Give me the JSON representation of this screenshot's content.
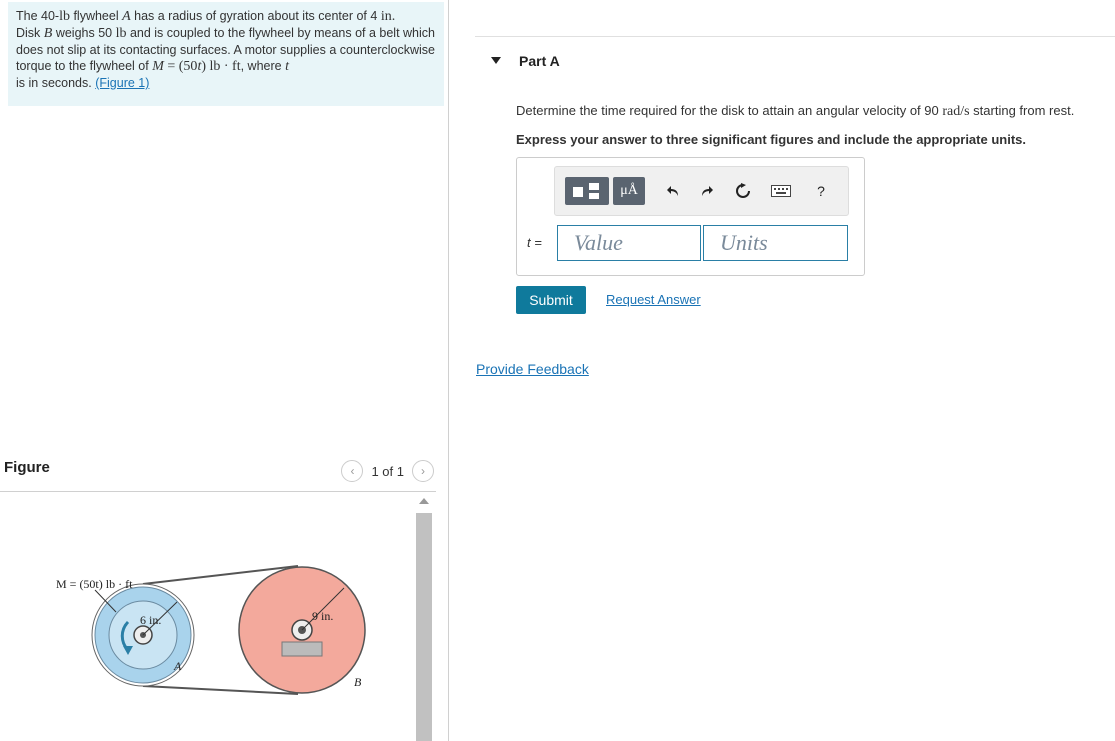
{
  "problem": {
    "s1": "The 40-",
    "m_lb1": "lb",
    "s2": " flywheel ",
    "m_A": "A",
    "s3": " has a radius of gyration about its center of 4 ",
    "m_in": "in.",
    "s4": "Disk ",
    "m_B": "B",
    "s5": " weighs 50 ",
    "m_lb2": "lb",
    "s6": " and is coupled to the flywheel by means of a belt which does not slip at its contacting surfaces. A motor supplies a counterclockwise torque to the flywheel of ",
    "m_M": "M",
    "m_eq": " = (50",
    "m_t": "t",
    "m_units": ") lb · ft",
    "s7": ", where ",
    "m_t2": "t",
    "s8": " is in seconds. ",
    "figure_link": "(Figure 1)"
  },
  "figure": {
    "title": "Figure",
    "pager": "1 of 1",
    "labels": {
      "moment": "M = (50t) lb · ft",
      "r_small": "6 in.",
      "r_big": "9 in.",
      "A": "A",
      "B": "B"
    },
    "colors": {
      "flywheel": "#a9d3ec",
      "disk": "#f3a99c"
    }
  },
  "part": {
    "label": "Part A",
    "question_a": "Determine the time required for the disk to attain an angular velocity of 90 ",
    "question_unit": "rad/s",
    "question_b": " starting from rest.",
    "instruction": "Express your answer to three significant figures and include the appropriate units."
  },
  "answer": {
    "var_label": "t =",
    "value_placeholder": "Value",
    "units_placeholder": "Units",
    "toolbar_icons": [
      "templates-icon",
      "units-icon",
      "undo-icon",
      "redo-icon",
      "reset-icon",
      "keyboard-icon",
      "help-icon"
    ],
    "units_glyph": "μÅ",
    "help_glyph": "?"
  },
  "actions": {
    "submit": "Submit",
    "request": "Request Answer",
    "feedback": "Provide Feedback"
  },
  "colors": {
    "accent": "#0f7a9c",
    "link": "#1a73b5",
    "problem_bg": "#e8f5f8"
  }
}
